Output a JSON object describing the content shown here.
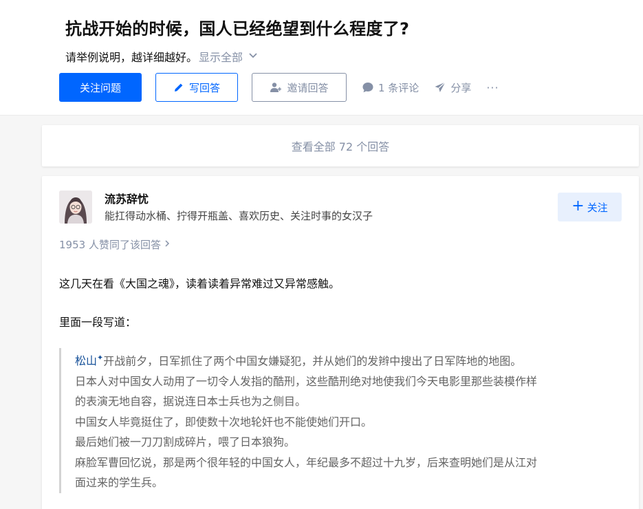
{
  "question": {
    "title": "抗战开始的时候，国人已经绝望到什么程度了?",
    "detail": "请举例说明，越详细越好。",
    "show_all": "显示全部"
  },
  "actions": {
    "follow": "关注问题",
    "write_answer": "写回答",
    "invite": "邀请回答",
    "comments": "1 条评论",
    "share": "分享",
    "more": "···"
  },
  "view_all_answers": "查看全部 72 个回答",
  "answer": {
    "author": {
      "name": "流苏辞忧",
      "bio": "能扛得动水桶、拧得开瓶盖、喜欢历史、关注时事的女汉子",
      "follow_label": "关注"
    },
    "votes": "1953 人赞同了该回答",
    "paragraphs": [
      "这几天在看《大国之魂》，读着读着异常难过又异常感触。",
      "里面一段写道："
    ],
    "quote": {
      "link_text": "松山",
      "link_mark": "✦",
      "line1_rest": "开战前夕，日军抓住了两个中国女嫌疑犯，并从她们的发辫中搜出了日军阵地的地图。",
      "lines": [
        "日本人对中国女人动用了一切令人发指的酷刑，这些酷刑绝对地使我们今天电影里那些装模作样",
        "的表演无地自容，据说连日本士兵也为之侧目。",
        "中国女人毕竟挺住了，即使数十次地轮奸也不能使她们开口。",
        "最后她们被一刀刀割成碎片，喂了日本狼狗。",
        "麻脸军曹回忆说，那是两个很年轻的中国女人，年纪最多不超过十九岁，后来查明她们是从江对",
        "面过来的学生兵。"
      ]
    }
  },
  "colors": {
    "primary": "#0066ff",
    "muted": "#8590a6",
    "link": "#175199",
    "background": "#f6f6f6"
  }
}
